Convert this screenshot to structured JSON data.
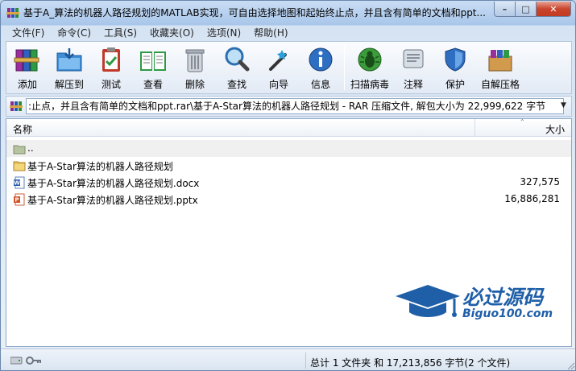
{
  "window": {
    "title": "基于A_算法的机器人路径规划的MATLAB实现，可自由选择地图和起始终止点，并且含有简单的文档和ppt...",
    "controls": {
      "minimize": "–",
      "maximize": "□",
      "close": "✕"
    }
  },
  "menu": [
    {
      "label": "文件(F)"
    },
    {
      "label": "命令(C)"
    },
    {
      "label": "工具(S)"
    },
    {
      "label": "收藏夹(O)"
    },
    {
      "label": "选项(N)"
    },
    {
      "label": "帮助(H)"
    }
  ],
  "toolbar": [
    {
      "label": "添加",
      "icon": "books-add-icon"
    },
    {
      "label": "解压到",
      "icon": "folder-extract-icon"
    },
    {
      "label": "测试",
      "icon": "clipboard-test-icon"
    },
    {
      "label": "查看",
      "icon": "book-view-icon"
    },
    {
      "label": "删除",
      "icon": "trash-icon"
    },
    {
      "label": "查找",
      "icon": "magnifier-icon"
    },
    {
      "label": "向导",
      "icon": "wand-icon"
    },
    {
      "label": "信息",
      "icon": "info-icon"
    },
    {
      "label": "扫描病毒",
      "icon": "bug-scan-icon"
    },
    {
      "label": "注释",
      "icon": "comment-icon"
    },
    {
      "label": "保护",
      "icon": "shield-icon"
    },
    {
      "label": "自解压格",
      "icon": "sfx-box-icon"
    }
  ],
  "address": {
    "path": ":止点，并且含有简单的文档和ppt.rar\\基于A-Star算法的机器人路径规划 - RAR 压缩文件, 解包大小为 22,999,622 字节"
  },
  "list": {
    "columns": {
      "name": "名称",
      "size": "大小"
    },
    "rows": [
      {
        "name": "..",
        "size": "",
        "type": "parent"
      },
      {
        "name": "基于A-Star算法的机器人路径规划",
        "size": "",
        "type": "folder"
      },
      {
        "name": "基于A-Star算法的机器人路径规划.docx",
        "size": "327,575",
        "type": "docx"
      },
      {
        "name": "基于A-Star算法的机器人路径规划.pptx",
        "size": "16,886,281",
        "type": "pptx"
      }
    ]
  },
  "watermark": {
    "brand": "必过源码",
    "url": "Biguo100.com"
  },
  "status": {
    "summary": "总计 1 文件夹 和 17,213,856 字节(2 个文件)"
  },
  "colors": {
    "accent": "#1f5fa8",
    "close": "#c9452d"
  }
}
